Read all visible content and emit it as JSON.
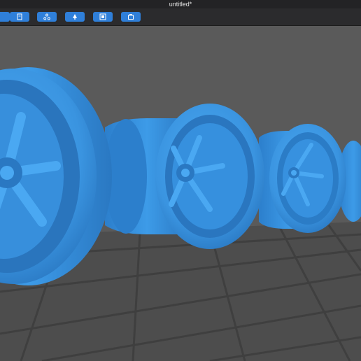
{
  "window": {
    "title": "untitled*"
  },
  "toolbar": {
    "buttons": [
      {
        "icon": "partial-left-icon"
      },
      {
        "icon": "document-icon"
      },
      {
        "icon": "share-network-icon"
      },
      {
        "icon": "support-tree-icon"
      },
      {
        "icon": "frame-icon"
      },
      {
        "icon": "package-icon"
      }
    ]
  },
  "colors": {
    "titlebar": "#232325",
    "toolbar": "#2b2b2d",
    "accent": "#2f7fd9",
    "model": "#3e9be8",
    "viewport": "#5a5a5a",
    "grid": "#3f3f3f"
  }
}
